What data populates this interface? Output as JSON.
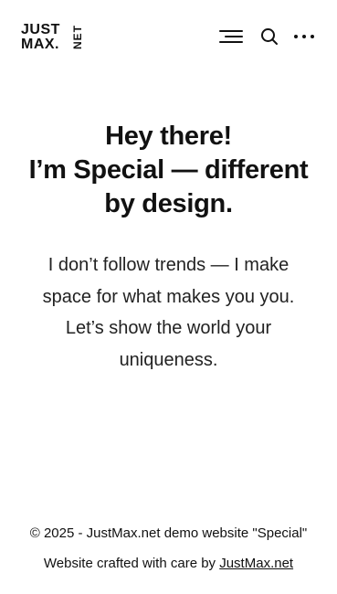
{
  "header": {
    "logo": {
      "line1": "JUST",
      "line2": "MAX.",
      "suffix": "NET"
    },
    "icons": [
      "menu-icon",
      "search-icon",
      "more-icon"
    ]
  },
  "hero": {
    "title_lines": [
      "Hey there!",
      "I’m Special — different",
      "by design."
    ],
    "text_lines": [
      "I don’t follow trends — I make",
      "space for what makes you you.",
      "Let’s show the world your",
      "uniqueness."
    ]
  },
  "footer": {
    "copyright": "© 2025 - JustMax.net demo website \"Special\"",
    "crafted_prefix": "Website crafted with care by ",
    "crafted_link": "JustMax.net"
  }
}
